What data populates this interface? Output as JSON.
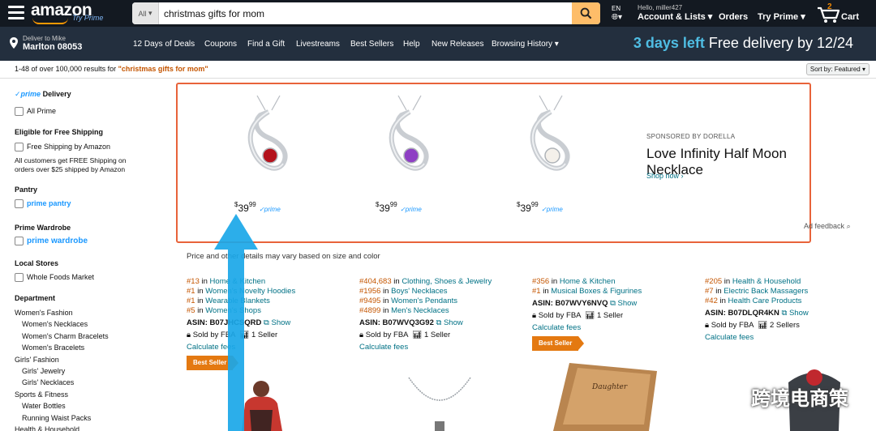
{
  "header": {
    "logo": "amazon",
    "try_prime": "Try Prime",
    "search_category": "All",
    "search_value": "christmas gifts for mom",
    "lang": "EN",
    "hello": "Hello, miller427",
    "account": "Account & Lists",
    "orders": "Orders",
    "try_prime_nav": "Try Prime",
    "cart_count": "2",
    "cart": "Cart"
  },
  "subnav": {
    "deliver_to": "Deliver to Mike",
    "location": "Marlton 08053",
    "links": [
      "12 Days of Deals",
      "Coupons",
      "Find a Gift",
      "Livestreams",
      "Best Sellers",
      "Help",
      "New Releases",
      "Browsing History"
    ],
    "promo_highlight": "3 days left",
    "promo_rest": "Free delivery by 12/24"
  },
  "results": {
    "count_text": "1-48 of over 100,000 results for ",
    "query": "\"christmas gifts for mom\"",
    "sort_label": "Sort by:",
    "sort_value": "Featured"
  },
  "sidebar": {
    "prime": "prime",
    "delivery": "Delivery",
    "all_prime": "All Prime",
    "free_shipping_h": "Eligible for Free Shipping",
    "free_shipping": "Free Shipping by Amazon",
    "free_shipping_note1": "All customers get FREE Shipping on",
    "free_shipping_note2": "orders over $25 shipped by Amazon",
    "pantry_h": "Pantry",
    "pantry": "prime pantry",
    "wardrobe_h": "Prime Wardrobe",
    "wardrobe": "prime wardrobe",
    "local_h": "Local Stores",
    "whole_foods": "Whole Foods Market",
    "department_h": "Department",
    "dept": [
      {
        "label": "Women's Fashion",
        "indent": false
      },
      {
        "label": "Women's Necklaces",
        "indent": true
      },
      {
        "label": "Women's Charm Bracelets",
        "indent": true
      },
      {
        "label": "Women's Bracelets",
        "indent": true
      },
      {
        "label": "Girls' Fashion",
        "indent": false
      },
      {
        "label": "Girls' Jewelry",
        "indent": true
      },
      {
        "label": "Girls' Necklaces",
        "indent": true
      },
      {
        "label": "Sports & Fitness",
        "indent": false
      },
      {
        "label": "Water Bottles",
        "indent": true
      },
      {
        "label": "Running Waist Packs",
        "indent": true
      },
      {
        "label": "Health & Household",
        "indent": false
      }
    ]
  },
  "ad": {
    "products": [
      {
        "dollars": "39",
        "cents": "99",
        "prime": "prime",
        "stone": "#b4121c"
      },
      {
        "dollars": "39",
        "cents": "99",
        "prime": "prime",
        "stone": "#8e3fc4"
      },
      {
        "dollars": "39",
        "cents": "99",
        "prime": "prime",
        "stone": "#f4f0ea"
      }
    ],
    "sponsored": "SPONSORED BY DORELLA",
    "title": "Love Infinity Half Moon Necklace",
    "shop_now": "Shop now ›",
    "ad_feedback": "Ad feedback"
  },
  "note": "Price and other details may vary based on size and color",
  "products": [
    {
      "ranks": [
        [
          "#13",
          "Home & Kitchen"
        ],
        [
          "#1",
          "Women's Novelty Hoodies"
        ],
        [
          "#1",
          "Wearable Blankets"
        ],
        [
          "#5",
          "Women's Shops"
        ]
      ],
      "asin": "B07JHCSQRD",
      "show": "Show",
      "sold": "Sold by FBA",
      "sellers": "1 Seller",
      "calc": "Calculate fees",
      "badge": "Best Seller"
    },
    {
      "ranks": [
        [
          "#404,683",
          "Clothing, Shoes & Jewelry"
        ],
        [
          "#1956",
          "Boys' Necklaces"
        ],
        [
          "#9495",
          "Women's Pendants"
        ],
        [
          "#4899",
          "Men's Necklaces"
        ]
      ],
      "asin": "B07WVQ3G92",
      "show": "Show",
      "sold": "Sold by FBA",
      "sellers": "1 Seller",
      "calc": "Calculate fees",
      "badge": ""
    },
    {
      "ranks": [
        [
          "#356",
          "Home & Kitchen"
        ],
        [
          "#1",
          "Musical Boxes & Figurines"
        ]
      ],
      "asin": "B07WVY6NVQ",
      "show": "Show",
      "sold": "Sold by FBA",
      "sellers": "1 Seller",
      "calc": "Calculate fees",
      "badge": "Best Seller"
    },
    {
      "ranks": [
        [
          "#205",
          "Health & Household"
        ],
        [
          "#7",
          "Electric Back Massagers"
        ],
        [
          "#42",
          "Health Care Products"
        ]
      ],
      "asin": "B07DLQR4KN",
      "show": "Show",
      "sold": "Sold by FBA",
      "sellers": "2 Sellers",
      "calc": "Calculate fees",
      "badge": ""
    }
  ],
  "asin_label": "ASIN:",
  "watermark": "跨境电商策",
  "colors": {
    "accent": "#febd69",
    "link": "#007185",
    "rank": "#c45500",
    "highlight_border": "#e8633a",
    "arrow": "#1aa7e8"
  }
}
